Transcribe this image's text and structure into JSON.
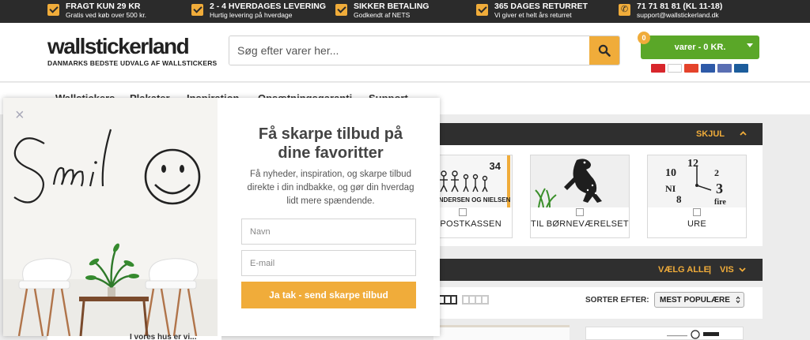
{
  "topbar": {
    "usps": [
      {
        "title": "FRAGT KUN 29 KR",
        "sub": "Gratis ved køb over 500 kr.",
        "icon": "check-icon"
      },
      {
        "title": "2 - 4 HVERDAGES LEVERING",
        "sub": "Hurtig levering på hverdage",
        "icon": "check-icon"
      },
      {
        "title": "SIKKER BETALING",
        "sub": "Godkendt af NETS",
        "icon": "check-icon"
      },
      {
        "title": "365 DAGES RETURRET",
        "sub": "Vi giver et helt års returret",
        "icon": "check-icon"
      },
      {
        "title": "71 71 81 81 (KL 11-18)",
        "sub": "support@wallstickerland.dk",
        "icon": "phone-icon"
      }
    ]
  },
  "header": {
    "logo_text": "wallstickerland",
    "tagline": "DANMARKS BEDSTE UDVALG AF WALLSTICKERS",
    "search_placeholder": "Søg efter varer her...",
    "cart_count": "0",
    "cart_label": "varer - 0 KR."
  },
  "nav": {
    "items": [
      "Wallstickers",
      "Plakater",
      "Inspiration",
      "Opsætningsgaranti",
      "Support"
    ]
  },
  "categories": {
    "toggle_label": "SKJUL",
    "cards": [
      {
        "label": "TIL POSTKASSEN",
        "visible_label": "L POSTKASSEN",
        "img_text": "34",
        "img_sub": "ANDERSEN OG NIELSEN"
      },
      {
        "label": "TIL BØRNEVÆRELSET"
      },
      {
        "label": "URE",
        "img_text": "12"
      }
    ]
  },
  "filter": {
    "select_all": "VÆLG ALLE",
    "separator": "|",
    "show": "VIS"
  },
  "sort": {
    "label": "SORTER EFTER:",
    "selected": "MEST POPULÆRE"
  },
  "modal": {
    "title": "Få skarpe tilbud på dine favoritter",
    "description": "Få nyheder, inspiration, og skarpe tilbud direkte i din indbakke, og gør din hverdag lidt mere spændende.",
    "name_placeholder": "Navn",
    "email_placeholder": "E-mail",
    "submit_label": "Ja tak - send skarpe tilbud",
    "close_symbol": "×",
    "art_text": "Smil"
  },
  "below": {
    "product_text": "I vores hus er vi..."
  },
  "colors": {
    "accent": "#f0ac3a",
    "cart_green": "#5aa728",
    "dark_bar": "#2b2b2b"
  }
}
